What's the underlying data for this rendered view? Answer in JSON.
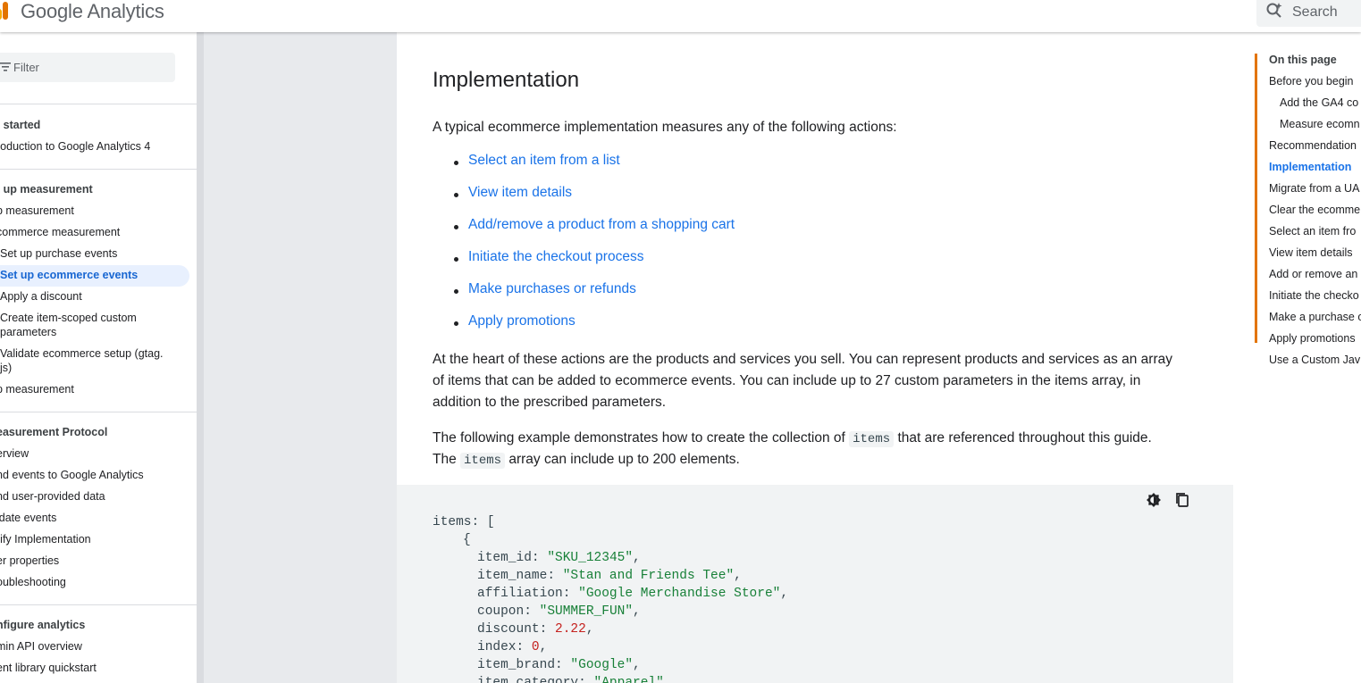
{
  "header": {
    "product_name": "Google Analytics",
    "search_placeholder": "Search"
  },
  "leftnav": {
    "filter_placeholder": "Filter",
    "sections": [
      {
        "heading": "t started",
        "items": [
          "roduction to Google Analytics 4"
        ]
      },
      {
        "heading": "t up measurement",
        "items": [
          "b measurement",
          "commerce measurement",
          "Set up purchase events",
          "Set up ecommerce events",
          "Apply a discount",
          "Create item-scoped custom parameters",
          "Validate ecommerce setup (gtag. js)",
          "p measurement"
        ]
      },
      {
        "heading": "easurement Protocol",
        "items": [
          "erview",
          "nd events to Google Analytics",
          "nd user-provided data",
          "idate events",
          "rify Implementation",
          "er properties",
          "oubleshooting"
        ]
      },
      {
        "heading": "nfigure analytics",
        "items": [
          "min API overview",
          "ent library quickstart"
        ]
      }
    ],
    "active_item": "Set up ecommerce events"
  },
  "main": {
    "title": "Implementation",
    "intro": "A typical ecommerce implementation measures any of the following actions:",
    "actions": [
      "Select an item from a list",
      "View item details",
      "Add/remove a product from a shopping cart",
      "Initiate the checkout process",
      "Make purchases or refunds",
      "Apply promotions"
    ],
    "para1_lines": [
      "At the heart of these actions are the products and services you sell. You can represent products and services as an array",
      "of items that can be added to ecommerce events. You can include up to 27 custom parameters in the items array, in",
      "addition to the prescribed parameters."
    ],
    "para2": {
      "part1": "The following example demonstrates how to create the collection of ",
      "code1": "items",
      "part2": " that are referenced throughout this guide.",
      "part3": "The ",
      "code2": "items",
      "part4": " array can include up to 200 elements."
    },
    "code": {
      "line_items": "items: [",
      "line_brace": "{",
      "fields": [
        {
          "key": "item_id: ",
          "value": "\"SKU_12345\"",
          "kind": "s"
        },
        {
          "key": "item_name: ",
          "value": "\"Stan and Friends Tee\"",
          "kind": "s"
        },
        {
          "key": "affiliation: ",
          "value": "\"Google Merchandise Store\"",
          "kind": "s"
        },
        {
          "key": "coupon: ",
          "value": "\"SUMMER_FUN\"",
          "kind": "s"
        },
        {
          "key": "discount: ",
          "value": "2.22",
          "kind": "n"
        },
        {
          "key": "index: ",
          "value": "0",
          "kind": "n"
        },
        {
          "key": "item_brand: ",
          "value": "\"Google\"",
          "kind": "s"
        },
        {
          "key": "item_category: ",
          "value": "\"Apparel\"",
          "kind": "s"
        }
      ]
    }
  },
  "toc": {
    "title": "On this page",
    "items": [
      {
        "label": "Before you begin",
        "indent": false
      },
      {
        "label": "Add the GA4 co",
        "indent": true
      },
      {
        "label": "Measure ecomn",
        "indent": true
      },
      {
        "label": "Recommendation",
        "indent": false
      },
      {
        "label": "Implementation",
        "indent": false
      },
      {
        "label": "Migrate from a UA",
        "indent": false
      },
      {
        "label": "Clear the ecomme",
        "indent": false
      },
      {
        "label": "Select an item fro",
        "indent": false
      },
      {
        "label": "View item details",
        "indent": false
      },
      {
        "label": "Add or remove an",
        "indent": false
      },
      {
        "label": "Initiate the checko",
        "indent": false
      },
      {
        "label": "Make a purchase o",
        "indent": false
      },
      {
        "label": "Apply promotions",
        "indent": false
      },
      {
        "label": "Use a Custom Jav",
        "indent": false
      }
    ],
    "active_index": 4
  },
  "colors": {
    "accent": "#1a73e8",
    "toc_bar": "#e37400",
    "string": "#188038",
    "number": "#c5221f",
    "logo": [
      "#f9ab00",
      "#e37400"
    ]
  }
}
